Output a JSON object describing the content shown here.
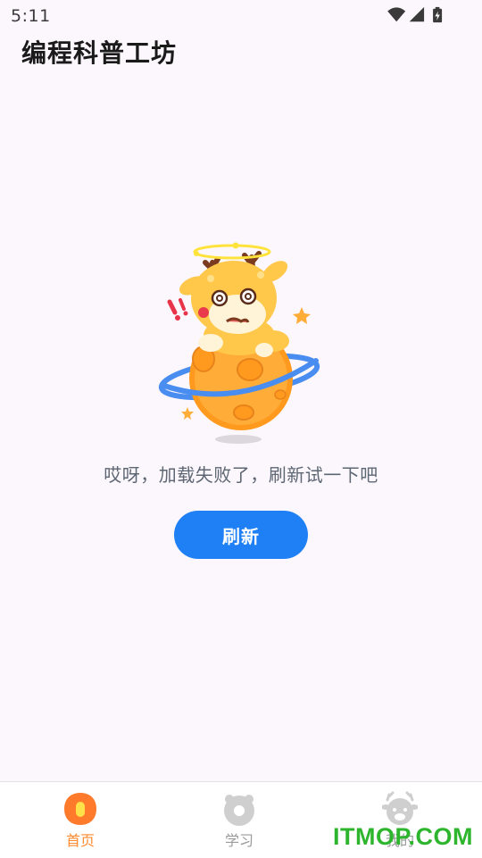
{
  "status_bar": {
    "time": "5:11",
    "icons": [
      "wifi-icon",
      "signal-icon",
      "battery-charging-icon"
    ]
  },
  "header": {
    "title": "编程科普工坊"
  },
  "error_state": {
    "illustration": "dizzy-deer-on-planet",
    "message": "哎呀，加载失败了，刷新试一下吧",
    "refresh_label": "刷新",
    "button_color": "#1f80f5"
  },
  "bottom_nav": {
    "items": [
      {
        "label": "首页",
        "icon": "home-icon",
        "active": true
      },
      {
        "label": "学习",
        "icon": "learn-icon",
        "active": false
      },
      {
        "label": "我的",
        "icon": "profile-icon",
        "active": false
      }
    ],
    "active_color": "#ff8a2e",
    "inactive_color": "#9a9a9a"
  },
  "watermark": "ITMOP.COM"
}
